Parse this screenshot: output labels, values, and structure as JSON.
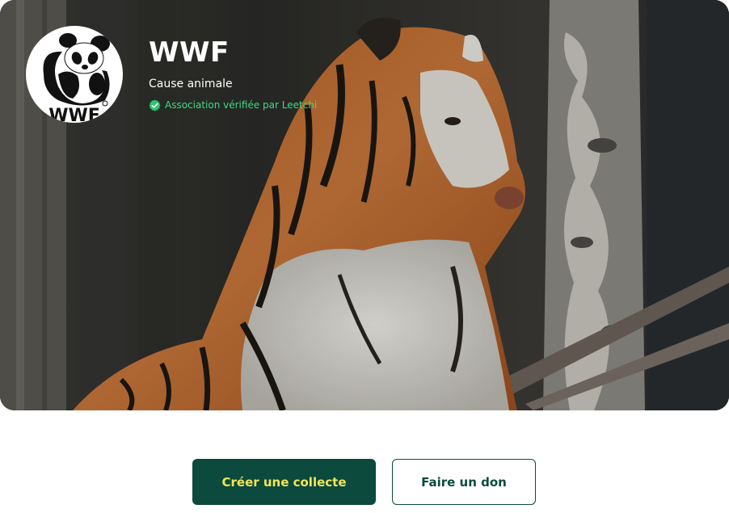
{
  "organization": {
    "name": "WWF",
    "cause": "Cause animale",
    "verified_label": "Association vérifiée par Leetchi",
    "logo_text": "WWF"
  },
  "hero": {
    "image_subject": "tiger-photo"
  },
  "actions": {
    "create_label": "Créer une collecte",
    "donate_label": "Faire un don"
  },
  "colors": {
    "brand_dark_green": "#0b4a3c",
    "primary_text_yellow": "#f3e45a",
    "verified_green": "#3ddc84"
  }
}
